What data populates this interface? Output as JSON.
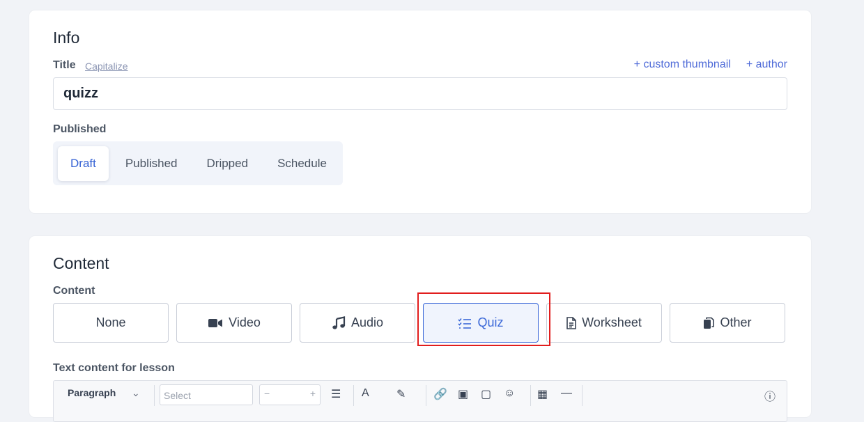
{
  "info": {
    "heading": "Info",
    "title_label": "Title",
    "capitalize_link": "Capitalize",
    "custom_thumbnail_link": "+ custom thumbnail",
    "author_link": "+ author",
    "title_value": "quizz",
    "published_label": "Published",
    "publish_options": [
      {
        "label": "Draft",
        "active": true
      },
      {
        "label": "Published",
        "active": false
      },
      {
        "label": "Dripped",
        "active": false
      },
      {
        "label": "Schedule",
        "active": false
      }
    ]
  },
  "content": {
    "heading": "Content",
    "content_label": "Content",
    "types": [
      {
        "label": "None",
        "icon": "none"
      },
      {
        "label": "Video",
        "icon": "video-icon"
      },
      {
        "label": "Audio",
        "icon": "music-note-icon"
      },
      {
        "label": "Quiz",
        "icon": "checklist-icon",
        "selected": true
      },
      {
        "label": "Worksheet",
        "icon": "document-icon"
      },
      {
        "label": "Other",
        "icon": "copy-icon"
      }
    ],
    "text_content_label": "Text content for lesson",
    "toolbar": {
      "paragraph_label": "Paragraph",
      "select_placeholder": "Select"
    }
  },
  "colors": {
    "accent": "#3b68d8",
    "link": "#4f6bd8",
    "highlight": "#e11d1d"
  }
}
